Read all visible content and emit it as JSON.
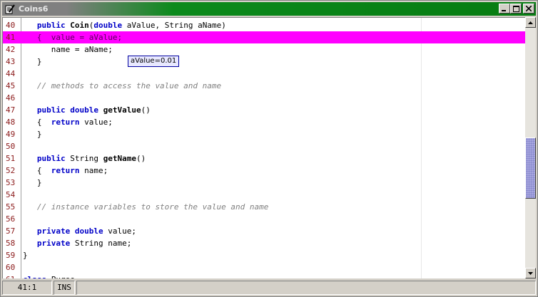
{
  "window": {
    "title": "Coins6",
    "icon": "edit-document-icon",
    "buttons": [
      "minimize-icon",
      "maximize-icon",
      "close-icon"
    ]
  },
  "editor": {
    "lines": [
      {
        "n": "40",
        "text": "   public Coin(double aValue, String aName)"
      },
      {
        "n": "41",
        "text": "   {  value = aValue;",
        "highlighted": true
      },
      {
        "n": "42",
        "text": "      name = aName;"
      },
      {
        "n": "43",
        "text": "   }"
      },
      {
        "n": "44",
        "text": ""
      },
      {
        "n": "45",
        "text": "   // methods to access the value and name"
      },
      {
        "n": "46",
        "text": ""
      },
      {
        "n": "47",
        "text": "   public double getValue()"
      },
      {
        "n": "48",
        "text": "   {  return value;"
      },
      {
        "n": "49",
        "text": "   }"
      },
      {
        "n": "50",
        "text": ""
      },
      {
        "n": "51",
        "text": "   public String getName()"
      },
      {
        "n": "52",
        "text": "   {  return name;"
      },
      {
        "n": "53",
        "text": "   }"
      },
      {
        "n": "54",
        "text": ""
      },
      {
        "n": "55",
        "text": "   // instance variables to store the value and name"
      },
      {
        "n": "56",
        "text": ""
      },
      {
        "n": "57",
        "text": "   private double value;"
      },
      {
        "n": "58",
        "text": "   private String name;"
      },
      {
        "n": "59",
        "text": "}"
      },
      {
        "n": "60",
        "text": ""
      },
      {
        "n": "61",
        "text": "class Purse"
      }
    ],
    "tooltip": "aValue=0.01"
  },
  "statusbar": {
    "position": "41:1",
    "mode": "INS",
    "message": ""
  },
  "colors": {
    "highlight": "#ff00ff",
    "keyword": "#0000c8",
    "comment": "#808080",
    "line_number": "#8b1a1a",
    "titlebar": "#0c8a1c"
  }
}
